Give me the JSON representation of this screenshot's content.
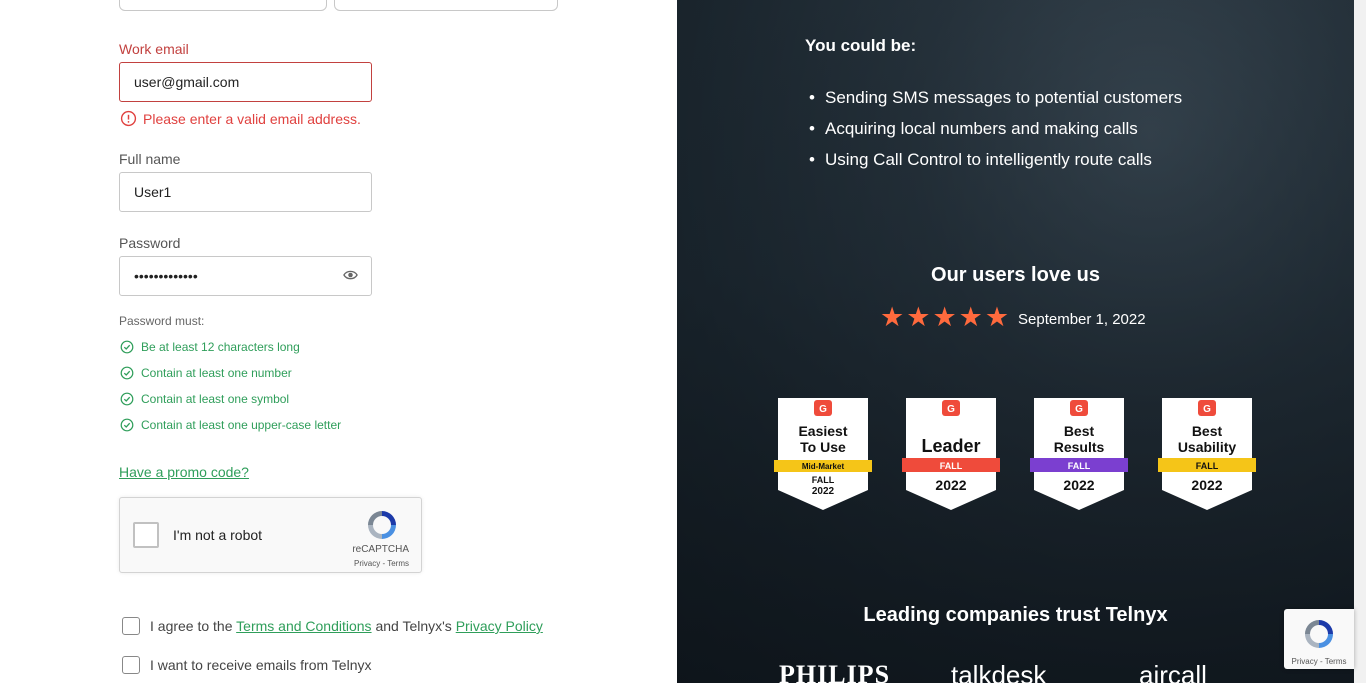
{
  "form": {
    "email": {
      "label": "Work email",
      "value": "user@gmail.com",
      "error": "Please enter a valid email address."
    },
    "full_name": {
      "label": "Full name",
      "value": "User1"
    },
    "password": {
      "label": "Password",
      "value": "•••••••••••••"
    },
    "requirements_title": "Password must:",
    "requirements": [
      "Be at least 12 characters long",
      "Contain at least one number",
      "Contain at least one symbol",
      "Contain at least one upper-case letter"
    ],
    "promo_link": "Have a promo code?",
    "captcha": {
      "label": "I'm not a robot",
      "brand": "reCAPTCHA",
      "links": "Privacy - Terms"
    },
    "agree": {
      "prefix": "I agree to the",
      "terms_link": "Terms and Conditions",
      "middle": "and Telnyx's",
      "privacy_link": "Privacy Policy"
    },
    "emails_opt_in": "I want to receive emails from Telnyx"
  },
  "promo_panel": {
    "heading": "You could be:",
    "bullets": [
      "Sending SMS messages to potential customers",
      "Acquiring local numbers and making calls",
      "Using Call Control to intelligently route calls"
    ],
    "users_title": "Our users love us",
    "rating_stars": 5,
    "rating_date": "September 1, 2022",
    "badges": [
      {
        "title1": "Easiest",
        "title2": "To Use",
        "ribbon": "Mid-Market",
        "season": "FALL",
        "year": "2022",
        "ribbon_color": "#f5c518"
      },
      {
        "title1": "Leader",
        "title2": "",
        "ribbon": "FALL",
        "season": "",
        "year": "2022",
        "ribbon_color": "#ef4b3b"
      },
      {
        "title1": "Best",
        "title2": "Results",
        "ribbon": "FALL",
        "season": "",
        "year": "2022",
        "ribbon_color": "#7b3fd0"
      },
      {
        "title1": "Best",
        "title2": "Usability",
        "ribbon": "FALL",
        "season": "",
        "year": "2022",
        "ribbon_color": "#f5c518"
      }
    ],
    "trust_title": "Leading companies trust Telnyx",
    "logos": [
      "PHILIPS",
      "talkdesk",
      "aircall"
    ]
  },
  "recaptcha_float": {
    "text": "Privacy - Terms"
  },
  "colors": {
    "error": "#e0413f",
    "success": "#2f9e5a",
    "star": "#ff6a3d"
  }
}
